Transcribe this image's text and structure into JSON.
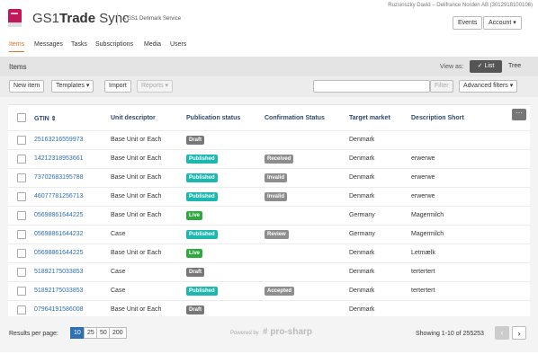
{
  "header": {
    "user_line": "Ruzsinszky David – Delifrance Norden AB (3012918100106)",
    "brand_prefix": "GS1",
    "brand_bold": "Trade",
    "brand_suffix": " Sync",
    "subtitle": "A GS1 Denmark Service",
    "events_label": "Events",
    "account_label": "Account ▾"
  },
  "nav": {
    "items": [
      "Items",
      "Messages",
      "Tasks",
      "Subscriptions",
      "Media",
      "Users"
    ],
    "active": "Items"
  },
  "section": {
    "title": "Items",
    "view_as_label": "View as:",
    "list_label": "✓ List",
    "tree_label": "Tree"
  },
  "toolbar": {
    "new_item": "New item",
    "templates": "Templates ▾",
    "import": "Import",
    "reports": "Reports ▾",
    "search_placeholder": "",
    "filter": "Filter",
    "advanced_filters": "Advanced filters ▾"
  },
  "table": {
    "columns": [
      "GTIN ⇕",
      "Unit descriptor",
      "Publication status",
      "Confirmation Status",
      "Target market",
      "Description Short"
    ],
    "more_label": "···",
    "rows": [
      {
        "gtin": "25163216559973",
        "unit": "Base Unit or Each",
        "pub": "Draft",
        "conf": "",
        "market": "Denmark",
        "desc": ""
      },
      {
        "gtin": "14212318953661",
        "unit": "Base Unit or Each",
        "pub": "Published",
        "conf": "Received",
        "market": "Denmark",
        "desc": "erwerwe"
      },
      {
        "gtin": "73702683195788",
        "unit": "Base Unit or Each",
        "pub": "Published",
        "conf": "Invalid",
        "market": "Denmark",
        "desc": "erwerwe"
      },
      {
        "gtin": "46077781256713",
        "unit": "Base Unit or Each",
        "pub": "Published",
        "conf": "Invalid",
        "market": "Denmark",
        "desc": "erwerwe"
      },
      {
        "gtin": "05698861644225",
        "unit": "Base Unit or Each",
        "pub": "Live",
        "conf": "",
        "market": "Germany",
        "desc": "Magermilch"
      },
      {
        "gtin": "05698861644232",
        "unit": "Case",
        "pub": "Published",
        "conf": "Review",
        "market": "Germany",
        "desc": "Magermilch"
      },
      {
        "gtin": "05698861644225",
        "unit": "Base Unit or Each",
        "pub": "Live",
        "conf": "",
        "market": "Denmark",
        "desc": "Letmælk"
      },
      {
        "gtin": "51892175033853",
        "unit": "Case",
        "pub": "Draft",
        "conf": "",
        "market": "Denmark",
        "desc": "tertertert"
      },
      {
        "gtin": "51892175033853",
        "unit": "Case",
        "pub": "Published",
        "conf": "Accepted",
        "market": "Denmark",
        "desc": "tertertert"
      },
      {
        "gtin": "07964191586008",
        "unit": "Base Unit or Each",
        "pub": "Draft",
        "conf": "",
        "market": "Denmark",
        "desc": ""
      }
    ]
  },
  "footer": {
    "results_label": "Results per page:",
    "page_sizes": [
      "10",
      "25",
      "50",
      "200"
    ],
    "active_size": "10",
    "powered_by": "Powered by",
    "powered_brand": "# pro-sharp",
    "showing": "Showing 1-10 of 255253",
    "prev_icon": "‹",
    "next_icon": "›"
  },
  "colors": {
    "accent": "#e86c1f",
    "link": "#2f6fb3",
    "draft": "#777777",
    "published": "#1bb8b0",
    "live": "#2eaa3d",
    "confirmation": "#8d8d8d"
  }
}
